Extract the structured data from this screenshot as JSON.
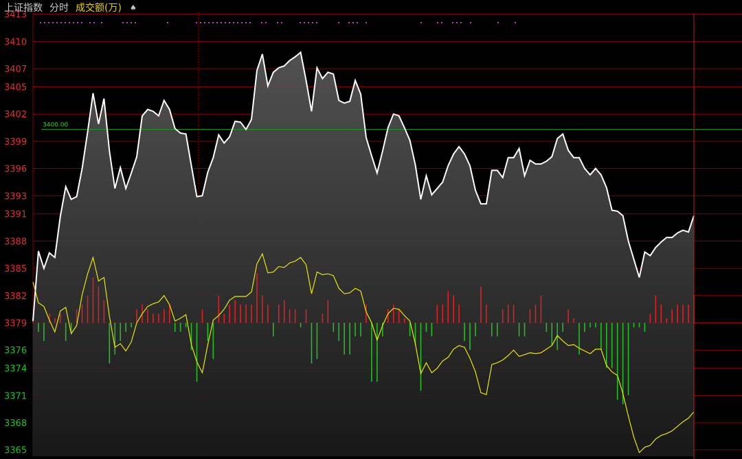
{
  "header": {
    "index_name": "上证指数",
    "period": "分时",
    "indicator": "成交额(万)",
    "menu_icon": "spade-icon"
  },
  "colors": {
    "background": "#000000",
    "grid": "#8a0000",
    "price_line": "#ffffff",
    "avg_line": "#e8e800",
    "up_bar": "#e02020",
    "down_bar": "#20c020",
    "ref_line": "#20a020",
    "axis_label_up": "#e03030",
    "axis_label_down": "#20c020",
    "marker": "#c040c0"
  },
  "chart_data": {
    "type": "line",
    "y_ticks": [
      3413,
      3410,
      3407,
      3405,
      3402,
      3399,
      3396,
      3393,
      3391,
      3388,
      3385,
      3382,
      3379,
      3376,
      3374,
      3371,
      3368,
      3365
    ],
    "ylim": [
      3364.3,
      3413.2
    ],
    "base_price": 3379,
    "reference": {
      "value": 3400.3,
      "label": "3400.00"
    },
    "price": [
      3379.2,
      3386.9,
      3385.0,
      3386.7,
      3386.2,
      3390.7,
      3394.0,
      3392.6,
      3392.9,
      3396.0,
      3400.0,
      3404.3,
      3400.9,
      3403.7,
      3397.9,
      3393.8,
      3396.1,
      3393.8,
      3395.5,
      3397.3,
      3401.8,
      3402.5,
      3402.3,
      3401.8,
      3403.5,
      3402.5,
      3400.4,
      3399.9,
      3399.8,
      3396.3,
      3392.9,
      3393.0,
      3395.6,
      3397.2,
      3399.7,
      3398.8,
      3399.5,
      3401.2,
      3401.1,
      3400.3,
      3401.4,
      3406.8,
      3408.6,
      3405.1,
      3406.6,
      3407.1,
      3407.3,
      3407.9,
      3408.3,
      3408.8,
      3405.7,
      3402.3,
      3407.1,
      3405.9,
      3406.6,
      3406.4,
      3403.5,
      3403.2,
      3403.4,
      3405.7,
      3404.2,
      3399.4,
      3397.4,
      3395.5,
      3397.9,
      3400.5,
      3402.0,
      3401.8,
      3400.5,
      3399.1,
      3396.4,
      3392.6,
      3395.2,
      3393.1,
      3393.8,
      3394.5,
      3396.3,
      3397.6,
      3398.4,
      3397.6,
      3396.3,
      3393.6,
      3392.1,
      3392.1,
      3395.8,
      3395.8,
      3395.0,
      3397.2,
      3397.2,
      3398.2,
      3395.2,
      3396.9,
      3396.5,
      3396.5,
      3396.8,
      3397.3,
      3399.3,
      3399.8,
      3398.0,
      3397.2,
      3397.2,
      3396.0,
      3395.3,
      3396.0,
      3395.3,
      3393.9,
      3391.4,
      3391.3,
      3390.8,
      3388.0,
      3386.0,
      3384.0,
      3386.8,
      3386.4,
      3387.3,
      3387.9,
      3388.4,
      3388.4,
      3388.9,
      3389.2,
      3389.0,
      3390.8
    ],
    "avg": [
      3383.5,
      3381.2,
      3380.8,
      3379.3,
      3378.0,
      3380.3,
      3380.7,
      3377.8,
      3378.7,
      3382.1,
      3384.4,
      3386.2,
      3383.6,
      3384.0,
      3379.7,
      3376.3,
      3376.7,
      3375.9,
      3376.9,
      3379.0,
      3380.0,
      3380.8,
      3381.1,
      3381.3,
      3382.0,
      3381.0,
      3379.2,
      3379.5,
      3379.9,
      3376.6,
      3374.7,
      3373.5,
      3376.6,
      3379.3,
      3379.8,
      3380.5,
      3381.5,
      3381.9,
      3381.9,
      3381.9,
      3382.4,
      3385.5,
      3386.6,
      3384.5,
      3384.6,
      3385.2,
      3385.1,
      3385.6,
      3385.8,
      3386.2,
      3385.4,
      3382.2,
      3384.6,
      3384.3,
      3384.4,
      3384.2,
      3382.8,
      3382.2,
      3382.3,
      3382.8,
      3382.5,
      3380.2,
      3379.0,
      3377.1,
      3378.7,
      3380.0,
      3380.6,
      3380.5,
      3379.8,
      3379.2,
      3376.7,
      3373.4,
      3374.6,
      3373.5,
      3374.0,
      3374.8,
      3375.2,
      3376.1,
      3376.5,
      3376.3,
      3375.1,
      3373.6,
      3371.3,
      3371.1,
      3374.4,
      3374.6,
      3374.9,
      3375.4,
      3376.0,
      3375.3,
      3375.5,
      3375.7,
      3375.6,
      3375.7,
      3376.1,
      3376.5,
      3377.6,
      3377.0,
      3376.5,
      3376.6,
      3376.2,
      3375.9,
      3375.6,
      3376.1,
      3376.1,
      3374.3,
      3373.6,
      3373.2,
      3371.2,
      3368.7,
      3366.4,
      3364.7,
      3365.3,
      3365.5,
      3366.2,
      3366.6,
      3366.8,
      3367.1,
      3367.6,
      3368.1,
      3368.5,
      3369.2
    ],
    "volume": [
      0.1,
      -0.2,
      -0.4,
      0.2,
      0.1,
      0.2,
      -0.4,
      -0.2,
      0.3,
      0.4,
      0.6,
      1.0,
      0.8,
      0.5,
      -0.9,
      -0.7,
      -0.4,
      -0.2,
      -0.1,
      0.3,
      0.4,
      0.3,
      0.2,
      0.2,
      0.3,
      0.4,
      -0.2,
      -0.2,
      -0.1,
      -0.6,
      -1.3,
      0.3,
      -0.4,
      -0.8,
      0.6,
      0.2,
      0.4,
      0.5,
      0.4,
      0.4,
      0.4,
      1.1,
      0.6,
      0.4,
      -0.3,
      0.4,
      0.5,
      0.3,
      0.3,
      -0.1,
      0.3,
      -0.9,
      -0.8,
      0.2,
      0.5,
      -0.2,
      -0.4,
      -0.7,
      -0.7,
      -0.3,
      -0.3,
      0.4,
      -1.3,
      -1.3,
      -0.3,
      0.3,
      0.4,
      0.3,
      0.1,
      -0.3,
      -0.5,
      -1.5,
      -0.2,
      -0.3,
      0.4,
      0.4,
      0.7,
      0.6,
      0.4,
      -0.4,
      -0.6,
      -0.3,
      0.8,
      0.4,
      -0.3,
      -0.3,
      0.3,
      0.4,
      0.4,
      -0.3,
      -0.3,
      0.3,
      0.4,
      0.6,
      -0.2,
      -0.5,
      -0.6,
      -0.2,
      0.3,
      0.1,
      -0.7,
      -0.2,
      -0.1,
      -0.1,
      -0.6,
      -1.0,
      -1.0,
      -1.7,
      -1.8,
      -1.6,
      -0.1,
      -0.1,
      -0.2,
      0.2,
      0.6,
      0.4,
      0.1,
      0.3,
      0.4,
      0.4,
      0.4,
      0.6
    ]
  }
}
